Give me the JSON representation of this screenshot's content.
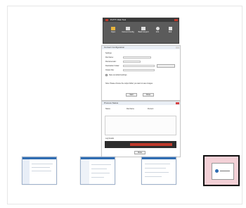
{
  "app": {
    "title": "PuTTY Disk Tool",
    "accent": "#c0392b",
    "toolbar_buttons": [
      {
        "label": "Open",
        "icon": "folder-icon"
      },
      {
        "label": "Convert Config",
        "icon": "convert-icon"
      },
      {
        "label": "Batch Export",
        "icon": "export-icon"
      },
      {
        "label": "Info",
        "icon": "info-icon"
      },
      {
        "label": "Exit",
        "icon": "exit-icon"
      }
    ]
  },
  "dialog": {
    "title": "Convert Configuration",
    "labels": [
      "Settings",
      "File Name:",
      "File Extension:",
      "Destination Folder:",
      "Output File:"
    ],
    "check_label": "Save as default settings",
    "note": "Note: Please choose the output folder you want to save images.",
    "ok": "Start",
    "cancel": "Close"
  },
  "status": {
    "title": "Process Status",
    "col1": "Status",
    "col2": "File Name",
    "col3": "Percent",
    "log_label": "Log Details",
    "close": "Close"
  },
  "thumbnails": [
    {
      "name": "thumbnail-explorer"
    },
    {
      "name": "thumbnail-settings-form"
    },
    {
      "name": "thumbnail-options-dialog"
    },
    {
      "name": "thumbnail-alert-dialog"
    }
  ]
}
